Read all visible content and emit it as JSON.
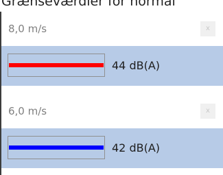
{
  "header": {
    "title": "Grænseværdier for normal"
  },
  "rows": [
    {
      "speed": "8,0 m/s",
      "clear_label": "x",
      "level": "44 dB(A)",
      "color": "#ff0000"
    },
    {
      "speed": "6,0 m/s",
      "clear_label": "x",
      "level": "42 dB(A)",
      "color": "#0000ff"
    }
  ]
}
